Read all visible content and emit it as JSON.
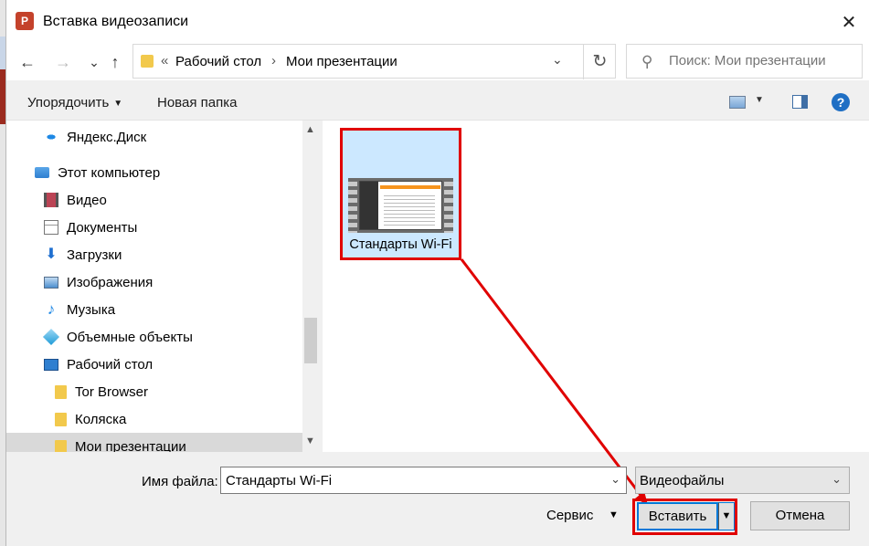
{
  "window": {
    "title": "Вставка видеозаписи",
    "app_icon_letter": "P",
    "close_glyph": "✕"
  },
  "nav": {
    "back": "←",
    "forward": "→",
    "recent": "⌄",
    "up": "↑",
    "address": {
      "prefix": "«",
      "crumbs": [
        "Рабочий стол",
        "Мои презентации"
      ],
      "separator": "›"
    },
    "refresh": "↻",
    "search_placeholder": "Поиск: Мои презентации"
  },
  "toolbar": {
    "organize": "Упорядочить",
    "new_folder": "Новая папка",
    "help": "?"
  },
  "sidebar": {
    "items": [
      {
        "label": "Яндекс.Диск",
        "icon": "cloud-icon"
      },
      {
        "label": "Этот компьютер",
        "icon": "computer-icon"
      },
      {
        "label": "Видео",
        "icon": "video-folder-icon"
      },
      {
        "label": "Документы",
        "icon": "documents-icon"
      },
      {
        "label": "Загрузки",
        "icon": "downloads-icon"
      },
      {
        "label": "Изображения",
        "icon": "pictures-icon"
      },
      {
        "label": "Музыка",
        "icon": "music-icon"
      },
      {
        "label": "Объемные объекты",
        "icon": "3d-objects-icon"
      },
      {
        "label": "Рабочий стол",
        "icon": "desktop-icon"
      },
      {
        "label": "Tor Browser",
        "icon": "folder-icon"
      },
      {
        "label": "Коляска",
        "icon": "folder-icon"
      },
      {
        "label": "Мои презентации",
        "icon": "folder-icon",
        "selected": true
      }
    ]
  },
  "files": [
    {
      "name": "Стандарты Wi-Fi",
      "type": "video",
      "selected": true
    }
  ],
  "footer": {
    "filename_label": "Имя файла:",
    "filename_value": "Стандарты Wi-Fi",
    "filetype": "Видеофайлы",
    "service": "Сервис",
    "insert": "Вставить",
    "cancel": "Отмена"
  },
  "colors": {
    "highlight_red": "#e00000",
    "selection_blue": "#cce8ff",
    "accent": "#0078d7"
  }
}
